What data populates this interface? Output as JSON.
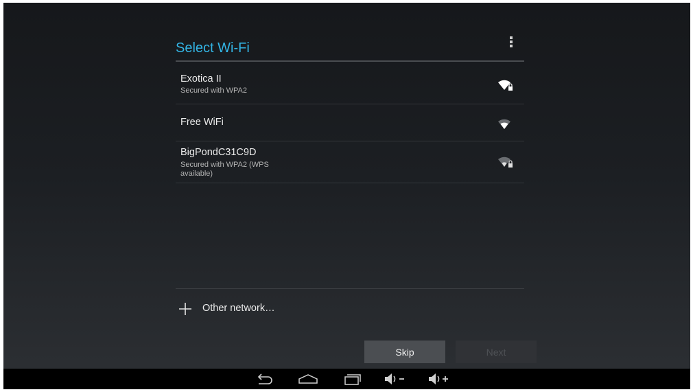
{
  "dialog": {
    "title": "Select Wi-Fi"
  },
  "networks": [
    {
      "name": "Exotica II",
      "status": "Secured with WPA2",
      "secured": true,
      "signal": "strong"
    },
    {
      "name": "Free WiFi",
      "status": "",
      "secured": false,
      "signal": "medium"
    },
    {
      "name": "BigPondC31C9D",
      "status": "Secured with WPA2 (WPS available)",
      "secured": true,
      "signal": "weak"
    }
  ],
  "other_network": {
    "label": "Other network…",
    "icon": "plus-icon"
  },
  "buttons": {
    "skip_label": "Skip",
    "next_label": "Next"
  },
  "navbar": {
    "icons": [
      "back-icon",
      "home-icon",
      "recent-apps-icon",
      "volume-down-icon",
      "volume-up-icon"
    ]
  },
  "colors": {
    "accent": "#33b5e5",
    "background": "#1c1f23",
    "navbar": "#000000"
  }
}
